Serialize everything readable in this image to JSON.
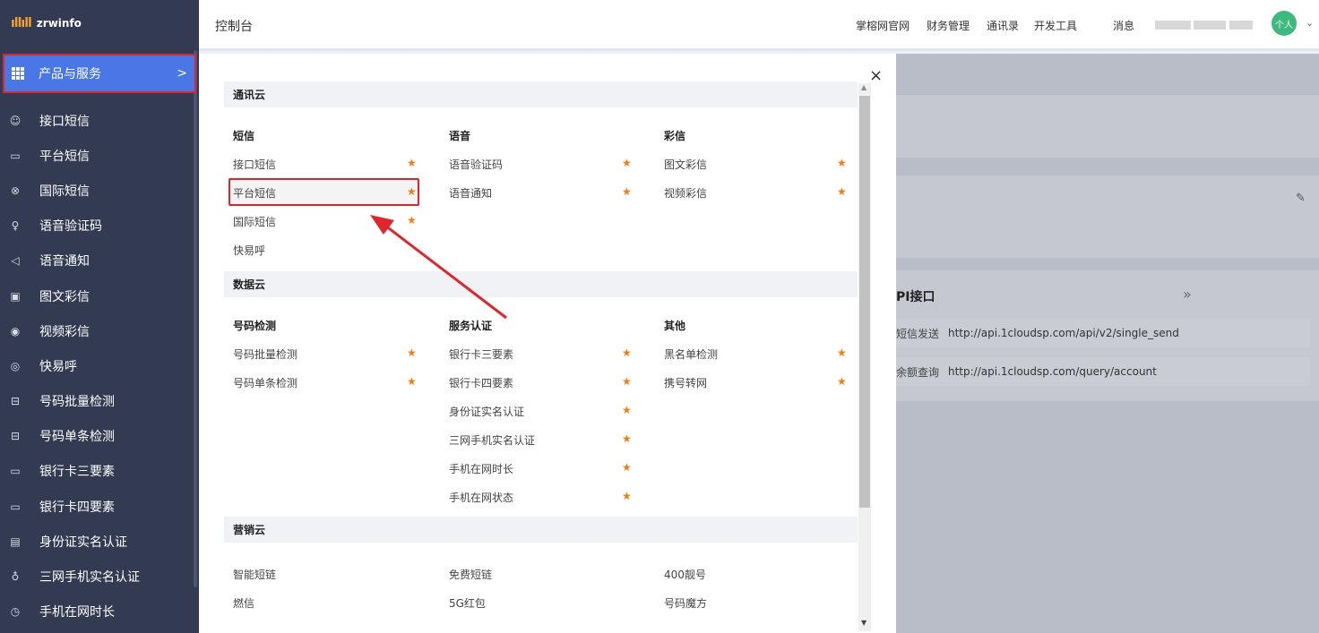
{
  "brand": {
    "logo_mark": "ıllıll",
    "name": "zrwinfo"
  },
  "sidebar": {
    "products": {
      "label": "产品与服务",
      "chevron": ">"
    },
    "items": [
      {
        "icon": "chat-bubble-icon",
        "glyph": "☺",
        "label": "接口短信"
      },
      {
        "icon": "message-square-icon",
        "glyph": "▭",
        "label": "平台短信"
      },
      {
        "icon": "globe-icon",
        "glyph": "⊗",
        "label": "国际短信"
      },
      {
        "icon": "microphone-icon",
        "glyph": "♀",
        "label": "语音验证码"
      },
      {
        "icon": "speaker-icon",
        "glyph": "◁",
        "label": "语音通知"
      },
      {
        "icon": "image-icon",
        "glyph": "▣",
        "label": "图文彩信"
      },
      {
        "icon": "play-circle-icon",
        "glyph": "◉",
        "label": "视频彩信"
      },
      {
        "icon": "phone-circle-icon",
        "glyph": "◎",
        "label": "快易呼"
      },
      {
        "icon": "scan-icon",
        "glyph": "⊟",
        "label": "号码批量检测"
      },
      {
        "icon": "scan-icon",
        "glyph": "⊟",
        "label": "号码单条检测"
      },
      {
        "icon": "card-icon",
        "glyph": "▭",
        "label": "银行卡三要素"
      },
      {
        "icon": "card-icon",
        "glyph": "▭",
        "label": "银行卡四要素"
      },
      {
        "icon": "id-card-icon",
        "glyph": "▤",
        "label": "身份证实名认证"
      },
      {
        "icon": "user-icon",
        "glyph": "♁",
        "label": "三网手机实名认证"
      },
      {
        "icon": "clock-icon",
        "glyph": "◷",
        "label": "手机在网时长"
      }
    ]
  },
  "header": {
    "title": "控制台",
    "nav": [
      "掌榕网官网",
      "财务管理",
      "通讯录",
      "开发工具"
    ],
    "messages": "消息",
    "avatar_text": "个人",
    "avatar_chevron": "⌄"
  },
  "background": {
    "api_title": "PI接口",
    "api_more": "»",
    "rows": [
      {
        "label": "短信发送",
        "url": "http://api.1cloudsp.com/api/v2/single_send"
      },
      {
        "label": "余额查询",
        "url": "http://api.1cloudsp.com/query/account"
      }
    ],
    "edit_icon": "✎"
  },
  "modal": {
    "close": "×",
    "sections": [
      {
        "title": "通讯云",
        "columns": [
          {
            "title": "短信",
            "items": [
              "接口短信",
              "平台短信",
              "国际短信",
              "快易呼"
            ],
            "stars": [
              true,
              true,
              true,
              false
            ]
          },
          {
            "title": "语音",
            "items": [
              "语音验证码",
              "语音通知"
            ],
            "stars": [
              true,
              true
            ]
          },
          {
            "title": "彩信",
            "items": [
              "图文彩信",
              "视频彩信"
            ],
            "stars": [
              true,
              true
            ]
          }
        ]
      },
      {
        "title": "数据云",
        "columns": [
          {
            "title": "号码检测",
            "items": [
              "号码批量检测",
              "号码单条检测"
            ],
            "stars": [
              true,
              true
            ]
          },
          {
            "title": "服务认证",
            "items": [
              "银行卡三要素",
              "银行卡四要素",
              "身份证实名认证",
              "三网手机实名认证",
              "手机在网时长",
              "手机在网状态"
            ],
            "stars": [
              true,
              true,
              true,
              true,
              true,
              true
            ]
          },
          {
            "title": "其他",
            "items": [
              "黑名单检测",
              "携号转网"
            ],
            "stars": [
              true,
              true
            ]
          }
        ]
      },
      {
        "title": "营销云",
        "columns": [
          {
            "title": "",
            "items": [
              "智能短链",
              "燃信"
            ],
            "stars": [
              false,
              false
            ]
          },
          {
            "title": "",
            "items": [
              "免费短链",
              "5G红包"
            ],
            "stars": [
              false,
              false
            ]
          },
          {
            "title": "",
            "items": [
              "400靓号",
              "号码魔方"
            ],
            "stars": [
              false,
              false
            ]
          }
        ]
      }
    ],
    "star_glyph": "★",
    "annotation_color": "#e0262c"
  }
}
